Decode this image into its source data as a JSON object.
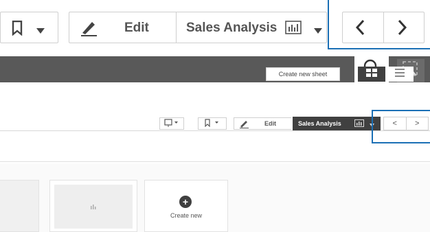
{
  "zoom": {
    "edit_label": "Edit",
    "sheet_title": "Sales Analysis",
    "nav_prev": "<",
    "nav_next": ">"
  },
  "small": {
    "edit_label": "Edit",
    "sheet_title": "Sales Analysis",
    "nav_prev": "<",
    "nav_next": ">",
    "create_new_sheet": "Create new sheet",
    "card_create_label": "Create new",
    "card_create_symbol": "+"
  },
  "colors": {
    "highlight": "#1a6fb5",
    "toolbar_dark": "#595959",
    "sheet_tab": "#404040"
  },
  "icons": [
    "bookmark-icon",
    "chevron-down-icon",
    "pencil-icon",
    "sheet-chart-icon",
    "chevron-left-icon",
    "chevron-right-icon",
    "search-icon",
    "selections-icon",
    "present-icon",
    "grid-view-icon",
    "list-view-icon",
    "create-new-icon"
  ]
}
